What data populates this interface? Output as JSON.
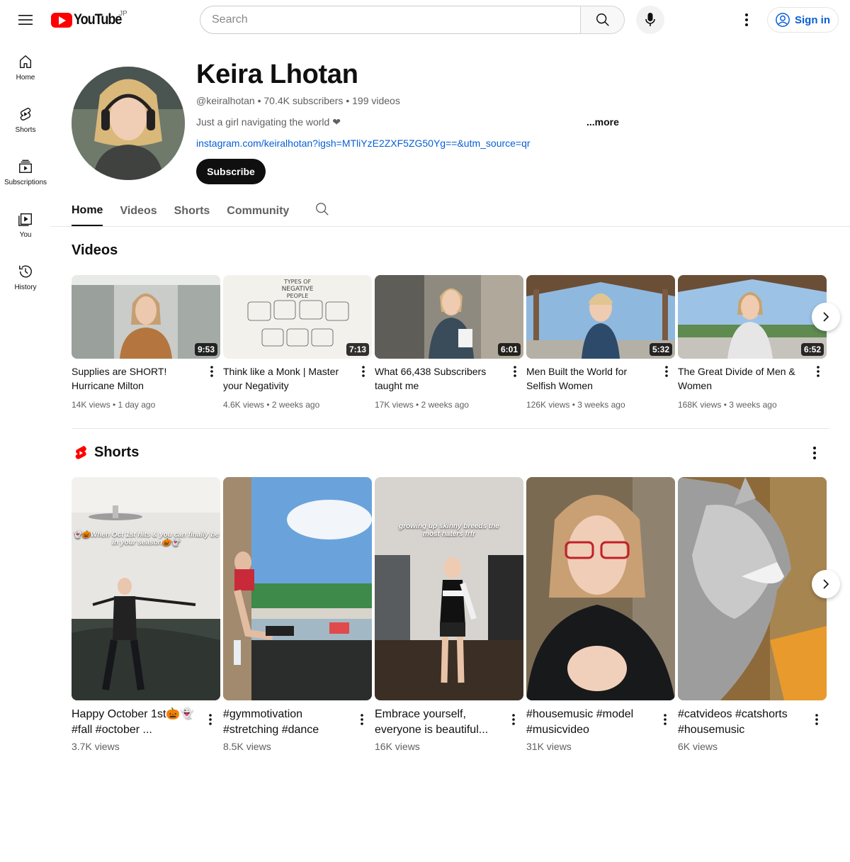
{
  "header": {
    "logo_text": "YouTube",
    "region": "JP",
    "search_placeholder": "Search",
    "sign_in": "Sign in"
  },
  "sidebar": {
    "items": [
      {
        "label": "Home",
        "icon": "home-icon"
      },
      {
        "label": "Shorts",
        "icon": "shorts-icon"
      },
      {
        "label": "Subscriptions",
        "icon": "subscriptions-icon"
      },
      {
        "label": "You",
        "icon": "you-icon"
      },
      {
        "label": "History",
        "icon": "history-icon"
      }
    ]
  },
  "channel": {
    "name": "Keira Lhotan",
    "meta": "@keiralhotan • 70.4K subscribers • 199 videos",
    "description": "Just a girl navigating the world ❤",
    "more": "...more",
    "link": "instagram.com/keiralhotan?igsh=MTliYzE2ZXF5ZG50Yg==&utm_source=qr",
    "subscribe": "Subscribe"
  },
  "tabs": [
    "Home",
    "Videos",
    "Shorts",
    "Community"
  ],
  "videos_section": {
    "title": "Videos",
    "items": [
      {
        "title": "Supplies are SHORT! Hurricane Milton",
        "meta": "14K views • 1 day ago",
        "duration": "9:53"
      },
      {
        "title": "Think like a Monk | Master your Negativity",
        "meta": "4.6K views • 2 weeks ago",
        "duration": "7:13"
      },
      {
        "title": "What 66,438 Subscribers taught me",
        "meta": "17K views • 2 weeks ago",
        "duration": "6:01"
      },
      {
        "title": "Men Built the World for Selfish Women",
        "meta": "126K views • 3 weeks ago",
        "duration": "5:32"
      },
      {
        "title": "The Great Divide of Men & Women",
        "meta": "168K views • 3 weeks ago",
        "duration": "6:52"
      }
    ]
  },
  "shorts_section": {
    "title": "Shorts",
    "items": [
      {
        "title": "Happy October 1st🎃👻 #fall #october ...",
        "meta": "3.7K views",
        "overlay": "👻🎃When Oct 1st hits & you can finally be in your season🎃👻"
      },
      {
        "title": "#gymmotivation #stretching #dance",
        "meta": "8.5K views",
        "overlay": ""
      },
      {
        "title": "Embrace yourself, everyone is beautiful...",
        "meta": "16K views",
        "overlay": "growing up skinny breeds the most haters frfr"
      },
      {
        "title": "#housemusic #model #musicvideo",
        "meta": "31K views",
        "overlay": ""
      },
      {
        "title": "#catvideos #catshorts #housemusic",
        "meta": "6K views",
        "overlay": ""
      }
    ]
  },
  "colors": {
    "brand_red": "#ff0000",
    "link_blue": "#065fd4",
    "text_secondary": "#606060"
  }
}
